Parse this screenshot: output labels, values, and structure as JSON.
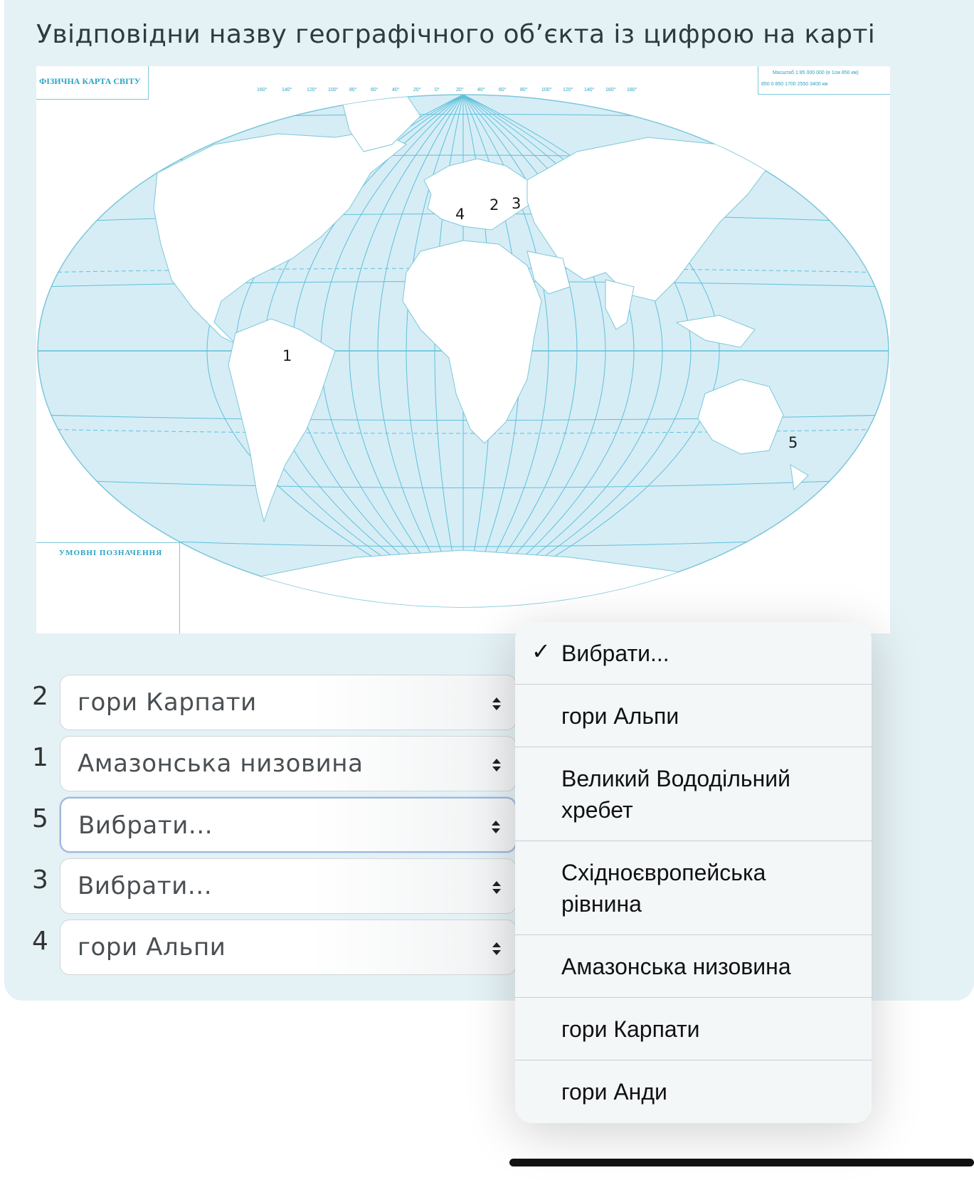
{
  "question": "Увідповідни назву географічного об’єкта із цифрою на карті",
  "map": {
    "title": "ФІЗИЧНА КАРТА СВІТУ",
    "legend_title": "УМОВНІ ПОЗНАЧЕННЯ",
    "scale_text": "Масштаб 1:85 000 000 (в 1см 850 км)",
    "scale_numbers": "850   0    850   1700   2550   3400 км",
    "markers": [
      "1",
      "2",
      "3",
      "4",
      "5"
    ]
  },
  "rows": [
    {
      "number": "2",
      "value": "гори Карпати"
    },
    {
      "number": "1",
      "value": "Амазонська низовина"
    },
    {
      "number": "5",
      "value": "Вибрати..."
    },
    {
      "number": "3",
      "value": "Вибрати..."
    },
    {
      "number": "4",
      "value": "гори Альпи"
    }
  ],
  "dropdown": {
    "checkmark": "✓",
    "options": [
      {
        "label": "Вибрати...",
        "selected": true
      },
      {
        "label": "гори Альпи",
        "selected": false
      },
      {
        "label": "Великий Вододільний хребет",
        "selected": false
      },
      {
        "label": "Східноєвропейська рівнина",
        "selected": false
      },
      {
        "label": "Амазонська низовина",
        "selected": false
      },
      {
        "label": "гори Карпати",
        "selected": false
      },
      {
        "label": "гори Анди",
        "selected": false
      }
    ]
  },
  "colors": {
    "card_background": "#e4f1f5",
    "ocean": "#d6edf6",
    "grid_lines": "#5fc0da",
    "focus_border": "#9eb9e0"
  }
}
